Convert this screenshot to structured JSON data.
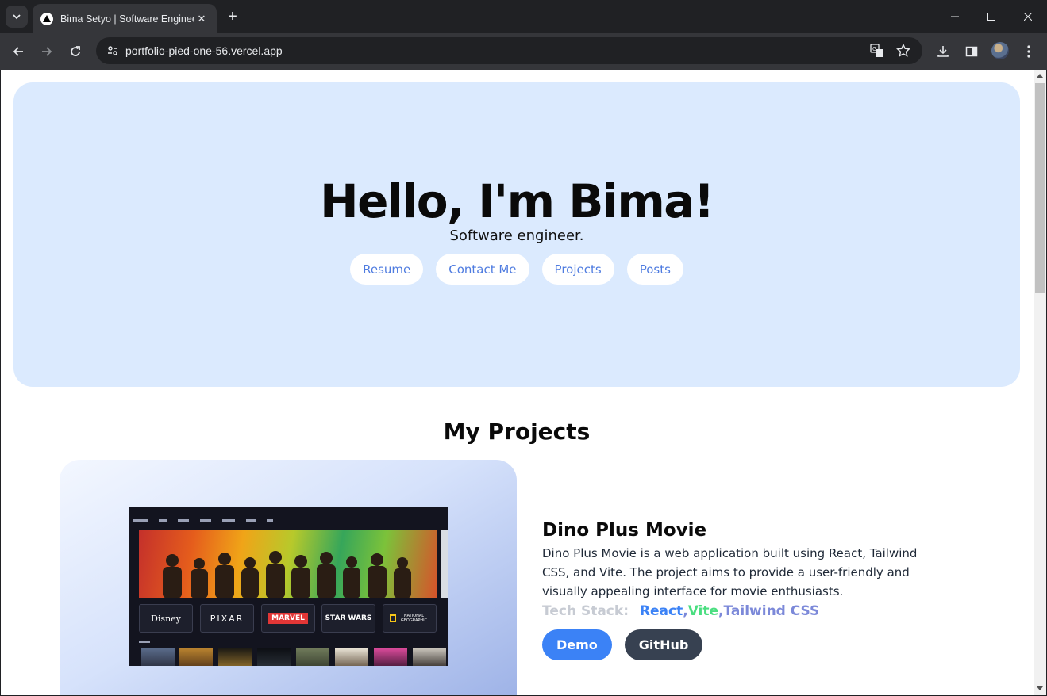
{
  "browser": {
    "tab_title": "Bima Setyo | Software Engineer",
    "url": "portfolio-pied-one-56.vercel.app"
  },
  "hero": {
    "title": "Hello, I'm Bima!",
    "subtitle": "Software engineer.",
    "links": [
      "Resume",
      "Contact Me",
      "Projects",
      "Posts"
    ]
  },
  "projects": {
    "heading": "My Projects",
    "items": [
      {
        "title": "Dino Plus Movie",
        "description": "Dino Plus Movie is a web application built using React, Tailwind CSS, and Vite. The project aims to provide a user-friendly and visually appealing interface for movie enthusiasts.",
        "stack_label": "Tech Stack:",
        "stack": [
          "React",
          "Vite",
          "Tailwind CSS"
        ],
        "demo_label": "Demo",
        "github_label": "GitHub",
        "screenshot_brands": [
          "Disney",
          "PIXAR",
          "MARVEL",
          "STAR WARS",
          "NATIONAL GEOGRAPHIC"
        ]
      }
    ]
  },
  "colors": {
    "hero_bg": "#dbeafe",
    "link_text": "#4f7ce0",
    "demo_button": "#3b82f6",
    "github_button": "#374151",
    "stack_react": "#3b82f6",
    "stack_vite": "#4ade80",
    "stack_tailwind": "#7c89d9"
  }
}
